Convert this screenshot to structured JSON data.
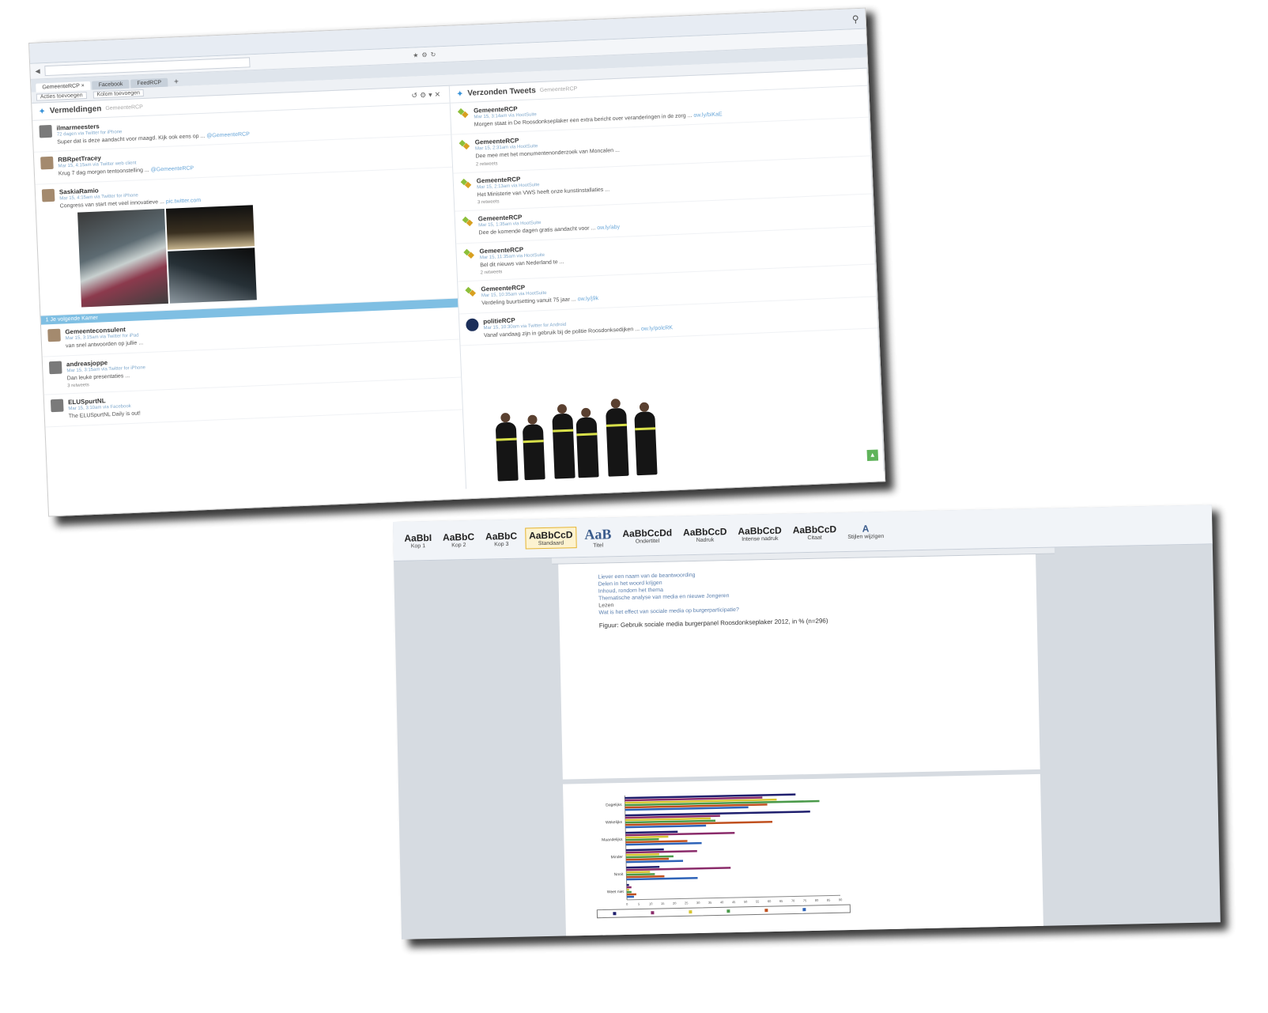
{
  "twitter_app": {
    "tabs": [
      "GemeenteRCP ×",
      "Facebook",
      "FeedRCP"
    ],
    "tab_add": "+",
    "subbar": [
      "Acties toevoegen",
      "Kolom toevoegen"
    ],
    "left_column": {
      "title": "Vermeldingen",
      "subtitle": "GemeenteRCP",
      "tweets": [
        {
          "user": "ilmarmeesters",
          "meta": "72 dagen via Twitter for iPhone",
          "text": "Super dat is deze aandacht voor maagd. Kijk ook eens op ...",
          "link": "@GemeenteRCP"
        },
        {
          "user": "RBRpetTracey",
          "meta": "Mar 15, 4:15am via Twitter web client",
          "text": "Krug 7 dag morgen tentoonstelling ...",
          "link": "@GemeenteRCP"
        },
        {
          "user": "SaskiaRamio",
          "meta": "Mar 15, 4:15am via Twitter for iPhone",
          "text": "Congress van start met veel innovatieve ...",
          "link": "pic.twitter.com"
        }
      ],
      "new_bar": "1 Je volgende Kamer",
      "tweets_after": [
        {
          "user": "Gemeenteconsulent",
          "meta": "Mar 15, 3:15am via Twitter for iPad",
          "text": "van snel antwoorden op jullie ..."
        },
        {
          "user": "andreasjoppe",
          "meta": "Mar 15, 3:15am via Twitter for iPhone",
          "text": "Dan leuke presentaties ...",
          "foot": "3 retweets"
        },
        {
          "user": "ELUSpurtNL",
          "meta": "Mar 15, 3:10am via Facebook",
          "text": "The ELUSpurtNL Daily is out!"
        }
      ]
    },
    "right_column": {
      "title": "Verzonden Tweets",
      "subtitle": "GemeenteRCP",
      "tweets": [
        {
          "user": "GemeenteRCP",
          "meta": "Mar 15, 3:14am via HootSuite",
          "text": "Morgen staat in De Roosdonkseplaker een extra bericht over veranderingen in de zorg ...",
          "link": "ow.ly/biKaE"
        },
        {
          "user": "GemeenteRCP",
          "meta": "Mar 15, 2:31am via HootSuite",
          "text": "Dee mee met het monumentenonderzoek van Moncalen ...",
          "foot": "2 retweets"
        },
        {
          "user": "GemeenteRCP",
          "meta": "Mar 15, 2:13am via HootSuite",
          "text": "Het Ministerie van VWS heeft onze kunstinstallaties ...",
          "foot": "3 retweets"
        },
        {
          "user": "GemeenteRCP",
          "meta": "Mar 15, 1:35am via HootSuite",
          "text": "Dee de komende dagen gratis aandacht voor ...",
          "link": "ow.ly/aby"
        },
        {
          "user": "GemeenteRCP",
          "meta": "Mar 15, 11:35am via HootSuite",
          "text": "Bel dit nieuws van Nederland te ...",
          "foot": "2 retweets"
        },
        {
          "user": "GemeenteRCP",
          "meta": "Mar 15, 10:35am via HootSuite",
          "text": "Verdeling buurtsetting vanuit 75 jaar ...",
          "link": "ow.ly/j9k"
        },
        {
          "user": "politieRCP",
          "meta": "Mar 15, 10:30am via Twitter for Android",
          "text": "Vanaf vandaag zijn in gebruik bij de politie Roosdonksedijken ...",
          "link": "ow.ly/polcRK"
        }
      ]
    }
  },
  "word_doc": {
    "ribbon_styles": [
      {
        "sample": "AaBbI",
        "label": "Kop 1"
      },
      {
        "sample": "AaBbC",
        "label": "Kop 2"
      },
      {
        "sample": "AaBbC",
        "label": "Kop 3"
      },
      {
        "sample": "AaBbCcD",
        "label": "Standaard",
        "selected": true
      },
      {
        "sample": "AaB",
        "label": "Titel",
        "big": true
      },
      {
        "sample": "AaBbCcDd",
        "label": "Ondertitel"
      },
      {
        "sample": "AaBbCcD",
        "label": "Nadruk"
      },
      {
        "sample": "AaBbCcD",
        "label": "Intense nadruk"
      },
      {
        "sample": "AaBbCcD",
        "label": "Citaat"
      }
    ],
    "change_styles": "Stijlen wijzigen",
    "lines": [
      "Liever een naam van de beantwoording",
      "Delen in het woord krijgen",
      "Inhoud, rondom het thema",
      "Thematische analyse van media en nieuwe Jongeren"
    ],
    "subhead": "Lezen",
    "subline": "Wat is het effect van sociale media op burgerparticipatie?",
    "caption": "Figuur: Gebruik sociale media burgerpanel Roosdonkseplaker 2012, in % (n=296)"
  },
  "chart_data": {
    "type": "bar",
    "orientation": "horizontal",
    "categories": [
      "Dagelijks",
      "Wekelijks",
      "Maandelijks",
      "Minder",
      "Nooit",
      "Weet niet"
    ],
    "series": [
      {
        "color": "#1f1f6e",
        "values": [
          72,
          78,
          22,
          16,
          14,
          1
        ]
      },
      {
        "color": "#8a2b6a",
        "values": [
          58,
          40,
          46,
          30,
          44,
          2
        ]
      },
      {
        "color": "#d7c531",
        "values": [
          64,
          36,
          18,
          14,
          10,
          1
        ]
      },
      {
        "color": "#4a9a4a",
        "values": [
          82,
          38,
          14,
          20,
          12,
          2
        ]
      },
      {
        "color": "#c0501e",
        "values": [
          60,
          62,
          26,
          18,
          16,
          4
        ]
      },
      {
        "color": "#2e63b8",
        "values": [
          52,
          34,
          32,
          24,
          30,
          3
        ]
      }
    ],
    "xlim": [
      0,
      90
    ],
    "ticks": [
      0,
      5,
      10,
      15,
      20,
      25,
      30,
      35,
      40,
      45,
      50,
      55,
      60,
      65,
      70,
      75,
      80,
      85,
      90
    ]
  }
}
